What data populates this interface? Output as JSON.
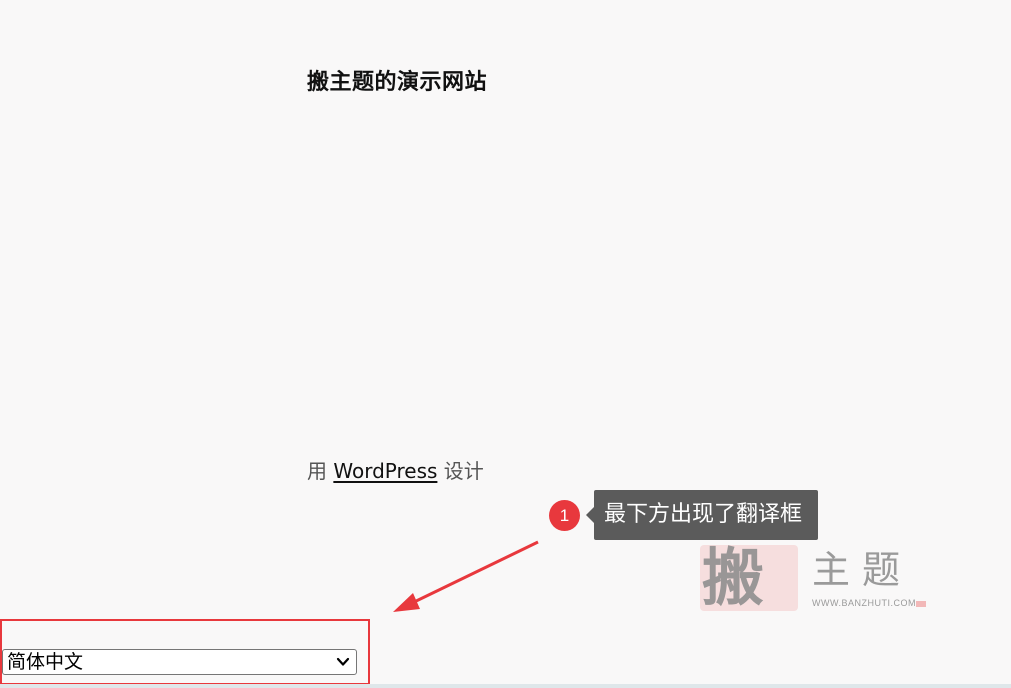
{
  "site": {
    "title": "搬主题的演示网站"
  },
  "footer": {
    "prefix": "用",
    "link_text": "WordPress",
    "suffix": "设计"
  },
  "callout": {
    "number": "1",
    "text": "最下方出现了翻译框",
    "color": "#e8383d"
  },
  "watermark": {
    "big_char": "搬",
    "chars": "主题",
    "url": "WWW.BANZHUTI.COM"
  },
  "language_select": {
    "selected": "简体中文",
    "icon": "chevron-down-icon"
  },
  "colors": {
    "background": "#f9f8f8",
    "annotation_red": "#e8383d",
    "bubble_gray": "#5b5b5b"
  }
}
